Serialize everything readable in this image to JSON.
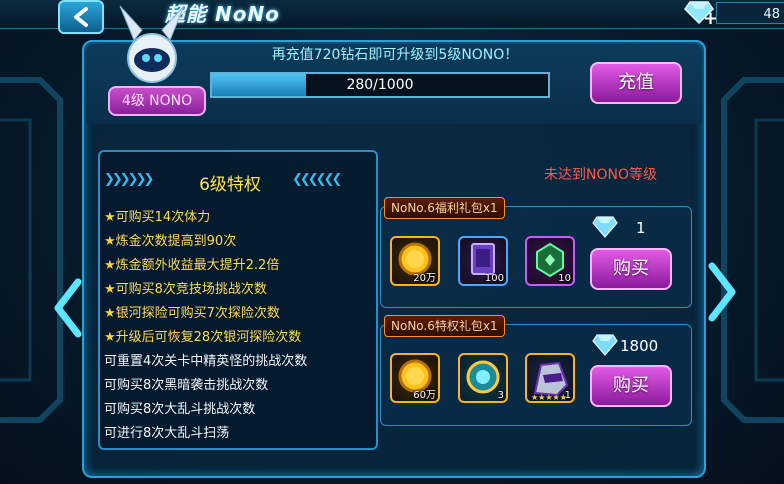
{
  "title": "超能 NoNo",
  "currency": {
    "value": "48",
    "icon": "diamond-icon"
  },
  "upgrade_hint": "再充值720钻石即可升级到5级NONO！",
  "level_badge": "4级 NONO",
  "exp": {
    "text": "280/1000",
    "progress": 0.28
  },
  "recharge_label": "充值",
  "privileges": {
    "title": "6级特权",
    "items": [
      {
        "star": "★",
        "text": "可购买14次体力",
        "style": "gold"
      },
      {
        "star": "★",
        "text": "炼金次数提高到90次",
        "style": "gold"
      },
      {
        "star": "★",
        "text": "炼金额外收益最大提升2.2倍",
        "style": "gold"
      },
      {
        "star": "★",
        "text": "可购买8次竞技场挑战次数",
        "style": "gold"
      },
      {
        "star": "★",
        "text": "银河探险可购买7次探险次数",
        "style": "gold"
      },
      {
        "star": "★",
        "text": "升级后可恢复28次银河探险次数",
        "style": "gold"
      },
      {
        "star": "",
        "text": "可重置4次关卡中精英怪的挑战次数",
        "style": "white"
      },
      {
        "star": "",
        "text": "可购买8次黑暗袭击挑战次数",
        "style": "white"
      },
      {
        "star": "",
        "text": "可购买8次大乱斗挑战次数",
        "style": "white"
      },
      {
        "star": "",
        "text": "可进行8次大乱斗扫荡",
        "style": "white"
      }
    ]
  },
  "not_reached": "未达到NONO等级",
  "packs": [
    {
      "tag": "NoNo.6福利礼包x1",
      "price": "1",
      "buy_label": "购买",
      "items": [
        {
          "icon": "gold-coin-icon",
          "qty": "20万"
        },
        {
          "icon": "purple-card-icon",
          "qty": "100"
        },
        {
          "icon": "green-crystal-icon",
          "qty": "10"
        }
      ]
    },
    {
      "tag": "NoNo.6特权礼包x1",
      "price": "1800",
      "buy_label": "购买",
      "items": [
        {
          "icon": "gold-coin-icon",
          "qty": "60万"
        },
        {
          "icon": "teal-orb-icon",
          "qty": "3"
        },
        {
          "icon": "armor-helmet-icon",
          "qty": "1"
        }
      ]
    }
  ],
  "colors": {
    "accent": "#2e9fd6",
    "button": "#c64fc9",
    "gold_text": "#ffd95a",
    "warning": "#ff5a4a"
  }
}
